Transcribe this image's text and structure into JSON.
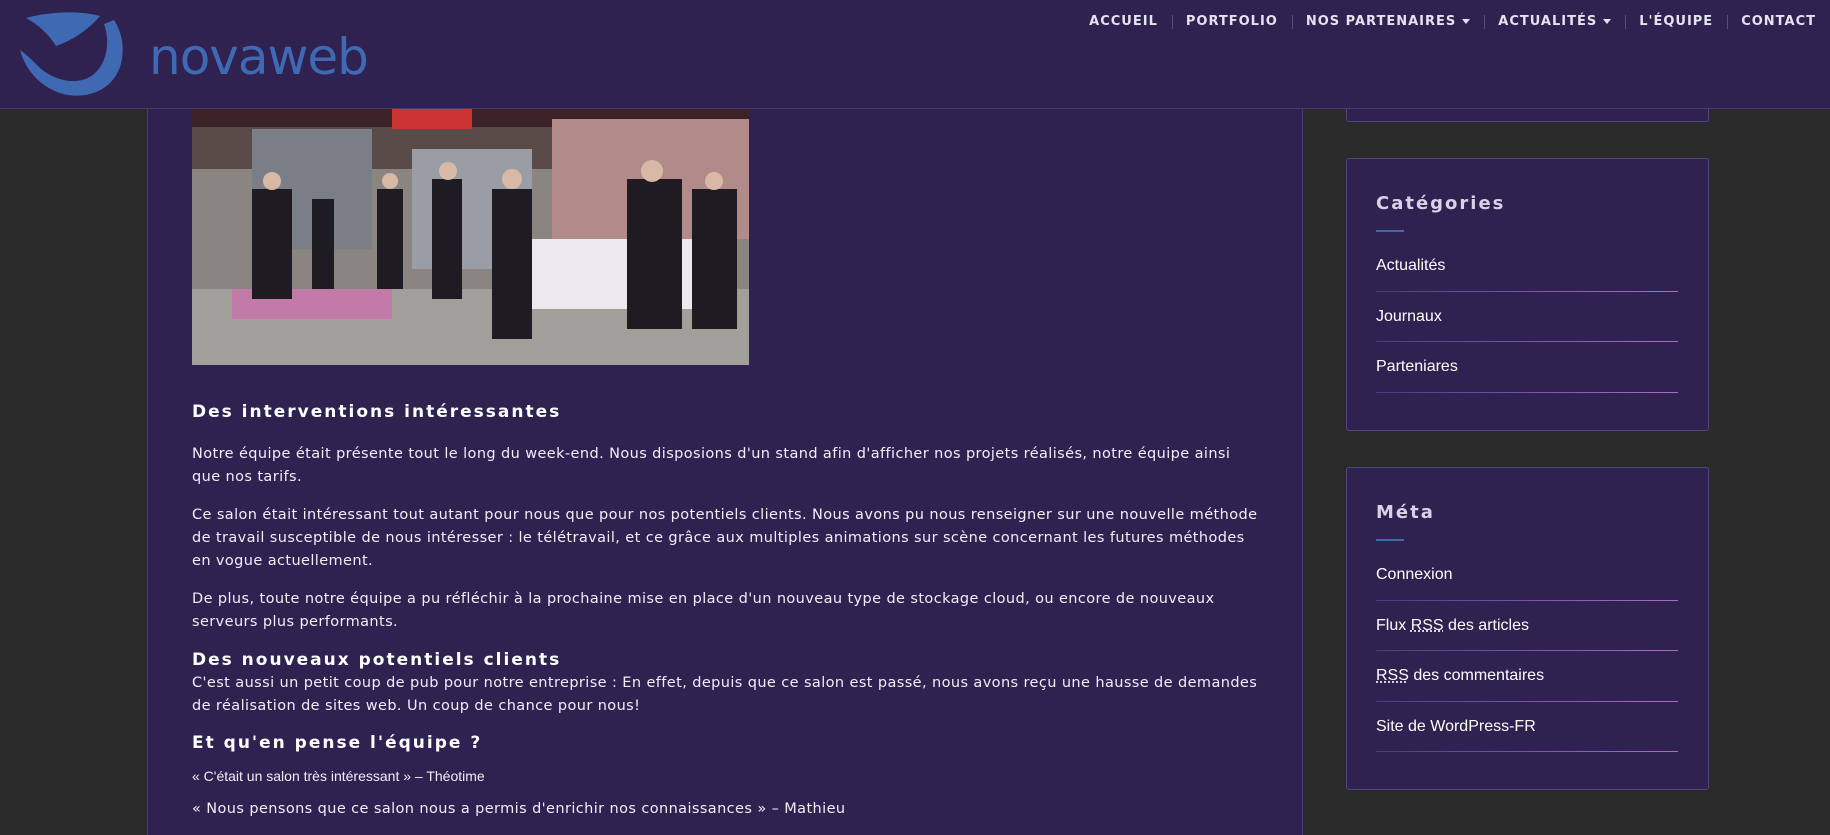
{
  "header": {
    "logo_text": "novaweb",
    "nav": [
      {
        "label": "ACCUEIL"
      },
      {
        "label": "PORTFOLIO"
      },
      {
        "label": "NOS PARTENAIRES"
      },
      {
        "label": "ACTUALITÉS"
      },
      {
        "label": "L'ÉQUIPE"
      },
      {
        "label": "CONTACT"
      }
    ]
  },
  "article": {
    "heading1": "Des interventions intéressantes",
    "para1": "Notre équipe était présente tout le long du week-end. Nous disposions d'un stand afin d'afficher nos projets réalisés, notre équipe ainsi que nos tarifs.",
    "para2": "Ce salon était intéressant tout autant pour nous que pour nos potentiels clients. Nous avons pu nous renseigner sur une nouvelle méthode de travail susceptible de nous intéresser : le télétravail, et ce grâce aux multiples animations sur scène concernant les futures méthodes en vogue actuellement.",
    "para3": "De plus, toute notre équipe a pu réfléchir à la prochaine mise en place d'un nouveau type de stockage cloud, ou encore de nouveaux serveurs plus performants.",
    "heading2": "Des nouveaux potentiels clients",
    "para4": "C'est aussi un petit coup de pub pour notre entreprise : En effet, depuis que ce salon est passé, nous avons reçu une hausse de demandes de réalisation de sites web. Un coup de chance pour nous!",
    "heading3": "Et qu'en pense l'équipe ?",
    "quote1": "« C'était un salon très intéressant » – Théotime",
    "quote2": "« Nous pensons que ce salon nous a permis d'enrichir nos connaissances » – Mathieu"
  },
  "sidebar": {
    "categories": {
      "title": "Catégories",
      "items": [
        "Actualités",
        "Journaux",
        "Parteniares"
      ]
    },
    "meta": {
      "title": "Méta",
      "items": {
        "login": "Connexion",
        "feed_prefix": "Flux",
        "feed_abbr": "RSS",
        "feed_suffix": "des articles",
        "comments_abbr": "RSS",
        "comments_suffix": "des commentaires",
        "wordpress": "Site de WordPress-FR"
      }
    }
  },
  "colors": {
    "header_bg": "#2f2150",
    "page_bg": "#2a2a2a",
    "brand_blue": "#3f6ab3",
    "accent_pink": "#b06ad0"
  }
}
